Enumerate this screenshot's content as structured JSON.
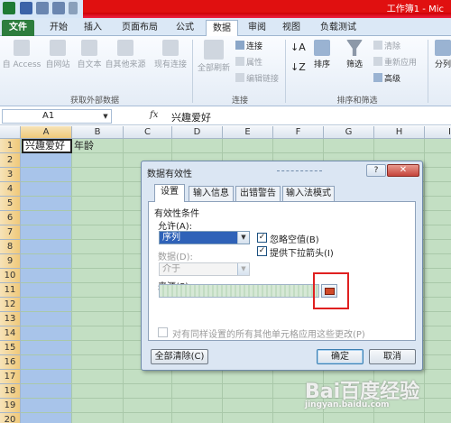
{
  "window": {
    "title": "工作簿1 - Mic"
  },
  "ribbon_tabs": [
    "文件",
    "开始",
    "插入",
    "页面布局",
    "公式",
    "数据",
    "审阅",
    "视图",
    "负载测试"
  ],
  "active_tab": "数据",
  "ribbon": {
    "get_external": {
      "items": [
        "自 Access",
        "自网站",
        "自文本",
        "自其他来源",
        "现有连接"
      ],
      "group_label": "获取外部数据"
    },
    "connections": {
      "refresh_all": "全部刷新",
      "items": [
        "连接",
        "属性",
        "编辑链接"
      ],
      "group_label": "连接"
    },
    "sort_filter": {
      "sort": "排序",
      "filter": "筛选",
      "items": [
        "清除",
        "重新应用",
        "高级"
      ],
      "group_label": "排序和筛选"
    },
    "split": "分列"
  },
  "formula_bar": {
    "name_box": "A1",
    "fx": "fx",
    "content": "兴趣爱好"
  },
  "grid": {
    "columns": [
      "A",
      "B",
      "C",
      "D",
      "E",
      "F",
      "G",
      "H",
      "I"
    ],
    "rows": [
      "1",
      "2",
      "3",
      "4",
      "5",
      "6",
      "7",
      "8",
      "9",
      "10",
      "11",
      "12",
      "13",
      "14",
      "15",
      "16",
      "17",
      "18",
      "19",
      "20"
    ],
    "a1": "兴趣爱好",
    "b1": "年龄"
  },
  "dialog": {
    "title": "数据有效性",
    "help": "?",
    "close": "✕",
    "tabs": [
      "设置",
      "输入信息",
      "出错警告",
      "输入法模式"
    ],
    "active_tab": "设置",
    "section": "有效性条件",
    "allow_label": "允许(A):",
    "allow_value": "序列",
    "data_label": "数据(D):",
    "data_value": "介于",
    "ignore_blank": "忽略空值(B)",
    "dropdown": "提供下拉箭头(I)",
    "source_label": "来源(S):",
    "apply_all": "对有同样设置的所有其他单元格应用这些更改(P)",
    "clear_all": "全部清除(C)",
    "ok": "确定",
    "cancel": "取消"
  },
  "watermark": {
    "main": "Bai百度经验",
    "sub": "jingyan.baidu.com"
  }
}
